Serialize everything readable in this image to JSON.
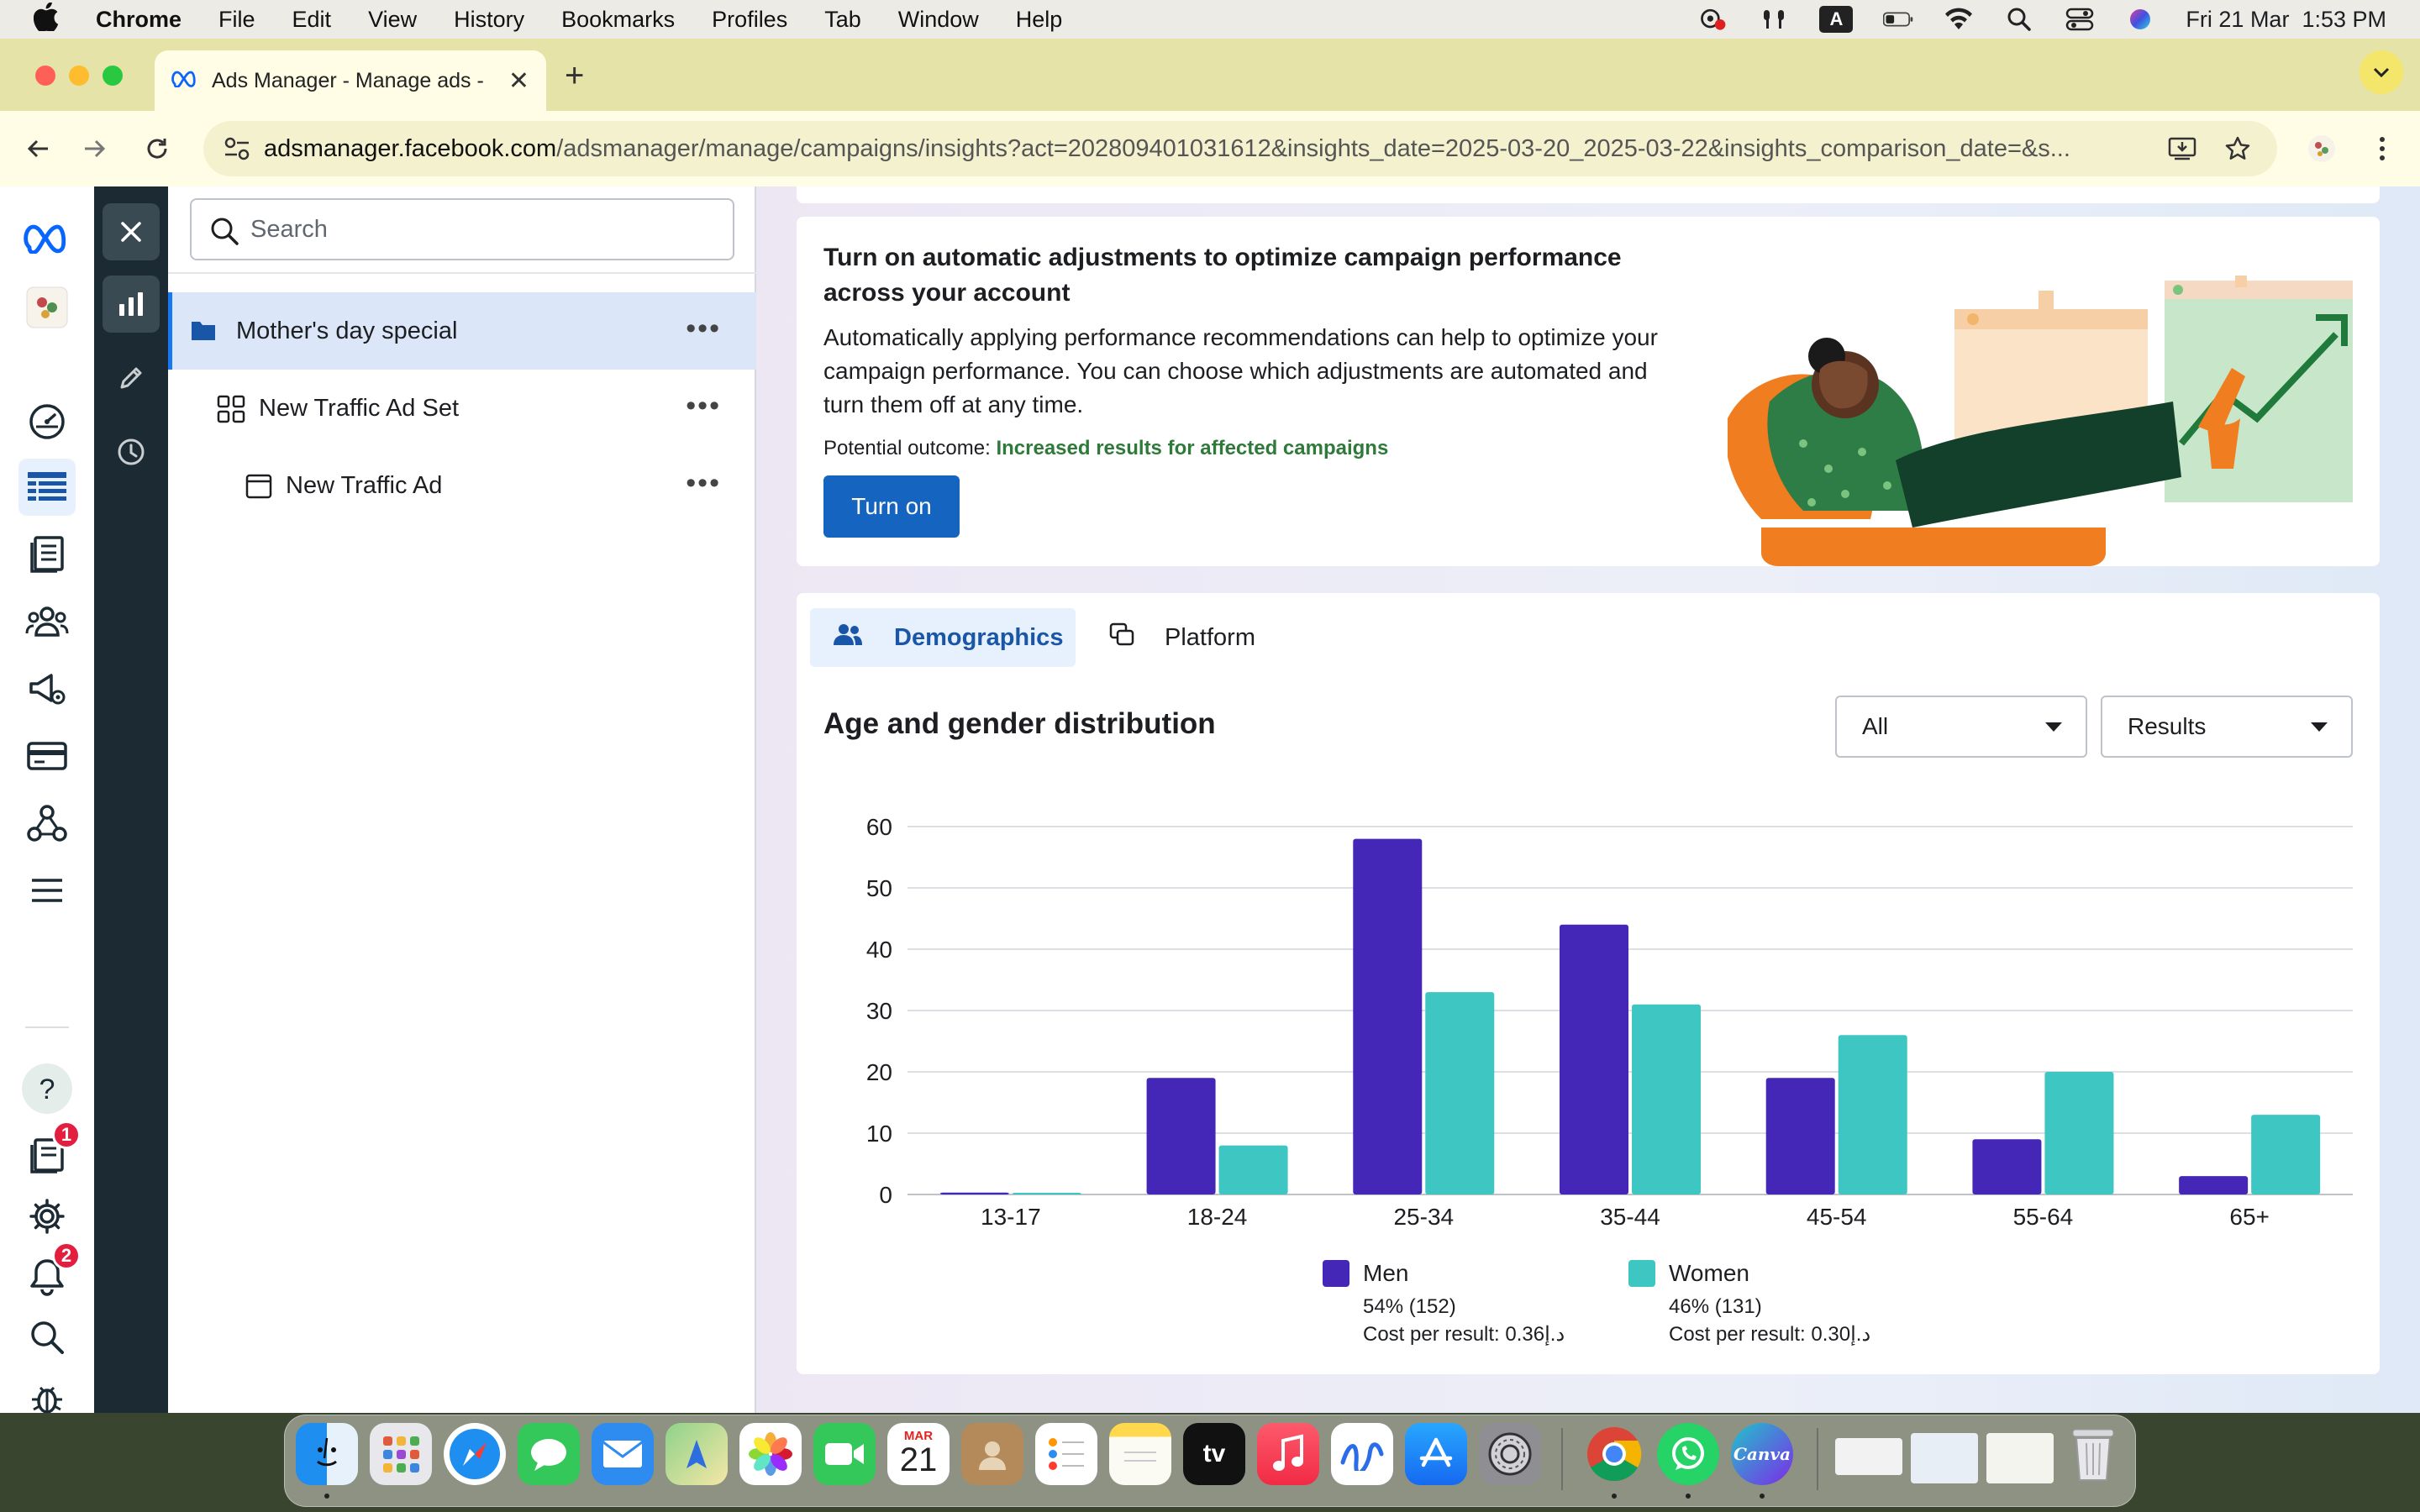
{
  "menubar": {
    "app_name": "Chrome",
    "items": [
      "File",
      "Edit",
      "View",
      "History",
      "Bookmarks",
      "Profiles",
      "Tab",
      "Window",
      "Help"
    ],
    "status_icons": [
      "screen-record-icon",
      "airpods-icon",
      "text-input-icon",
      "battery-icon",
      "wifi-icon",
      "spotlight-icon",
      "control-center-icon",
      "siri-icon"
    ],
    "input_source": "A",
    "clock": "Fri 21 Mar  1:53 PM"
  },
  "browser": {
    "tab_title": "Ads Manager - Manage ads -",
    "url_host": "adsmanager.facebook.com",
    "url_path": "/adsmanager/manage/campaigns/insights?act=202809401031612&insights_date=2025-03-20_2025-03-22&insights_comparison_date=&s..."
  },
  "tree": {
    "search_placeholder": "Search",
    "items": [
      {
        "label": "Mother's day special",
        "type": "campaign"
      },
      {
        "label": "New Traffic Ad Set",
        "type": "adset"
      },
      {
        "label": "New Traffic Ad",
        "type": "ad"
      }
    ]
  },
  "badges": {
    "ads_reporting": "1",
    "notifications": "2"
  },
  "promo": {
    "title": "Turn on automatic adjustments to optimize campaign performance across your account",
    "body": "Automatically applying performance recommendations can help to optimize your campaign performance. You can choose which adjustments are automated and turn them off at any time.",
    "outcome_label": "Potential outcome:",
    "outcome_value": "Increased results for affected campaigns",
    "button": "Turn on"
  },
  "breakdown": {
    "tabs": [
      {
        "label": "Demographics",
        "active": true
      },
      {
        "label": "Platform",
        "active": false
      }
    ],
    "chart_title": "Age and gender distribution",
    "filter_select": "All",
    "metric_select": "Results"
  },
  "chart_data": {
    "type": "bar",
    "title": "Age and gender distribution",
    "categories": [
      "13-17",
      "18-24",
      "25-34",
      "35-44",
      "45-54",
      "55-64",
      "65+"
    ],
    "series": [
      {
        "name": "Men",
        "color": "#4527b8",
        "values": [
          0.3,
          19,
          58,
          44,
          19,
          9,
          3
        ],
        "share": "54% (152)",
        "cost": "Cost per result: 0.36د.إ"
      },
      {
        "name": "Women",
        "color": "#3ec6c2",
        "values": [
          0.2,
          8,
          33,
          31,
          26,
          20,
          13
        ],
        "share": "46% (131)",
        "cost": "Cost per result: 0.30د.إ"
      }
    ],
    "yticks": [
      0,
      10,
      20,
      30,
      40,
      50,
      60
    ],
    "ylim": [
      0,
      60
    ],
    "grid": true,
    "legend_position": "bottom"
  },
  "colors": {
    "accent": "#1877f2",
    "button": "#1565c0",
    "men": "#4527b8",
    "women": "#3ec6c2",
    "outcome": "#2f7a3a"
  },
  "dock": {
    "apps": [
      "Finder",
      "Launchpad",
      "Safari",
      "Messages",
      "Mail",
      "Maps",
      "Photos",
      "FaceTime",
      "Calendar",
      "Contacts",
      "Reminders",
      "Notes",
      "TV",
      "Music",
      "Freeform",
      "App Store",
      "System Settings",
      "Chrome",
      "WhatsApp",
      "Canva",
      "Trash"
    ],
    "calendar_month": "MAR",
    "calendar_day": "21",
    "tv_label": "tv",
    "canva_label": "Canva"
  }
}
